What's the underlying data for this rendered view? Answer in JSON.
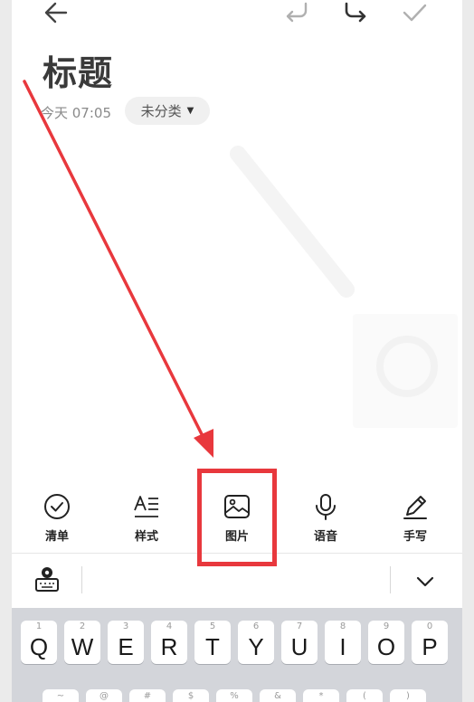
{
  "topbar": {
    "back_icon": "arrow-left-icon",
    "undo_icon": "undo-icon",
    "redo_icon": "redo-icon",
    "confirm_icon": "check-icon"
  },
  "note": {
    "title": "标题",
    "time": "今天 07:05",
    "category": "未分类"
  },
  "toolbar": {
    "items": [
      {
        "label": "清单",
        "icon": "checklist-icon"
      },
      {
        "label": "样式",
        "icon": "text-style-icon"
      },
      {
        "label": "图片",
        "icon": "image-icon"
      },
      {
        "label": "语音",
        "icon": "microphone-icon"
      },
      {
        "label": "手写",
        "icon": "pen-icon"
      }
    ],
    "highlighted": "图片"
  },
  "keyboard": {
    "toolbar_icon": "keyboard-settings-icon",
    "collapse_icon": "chevron-down-icon",
    "row1": [
      {
        "num": "1",
        "ch": "Q"
      },
      {
        "num": "2",
        "ch": "W"
      },
      {
        "num": "3",
        "ch": "E"
      },
      {
        "num": "4",
        "ch": "R"
      },
      {
        "num": "5",
        "ch": "T"
      },
      {
        "num": "6",
        "ch": "Y"
      },
      {
        "num": "7",
        "ch": "U"
      },
      {
        "num": "8",
        "ch": "I"
      },
      {
        "num": "9",
        "ch": "O"
      },
      {
        "num": "0",
        "ch": "P"
      }
    ],
    "row2_symbols": [
      "~",
      "@",
      "#",
      "$",
      "%",
      "&",
      "*",
      "(",
      ")"
    ]
  },
  "annotation": {
    "color": "#e8383d"
  }
}
